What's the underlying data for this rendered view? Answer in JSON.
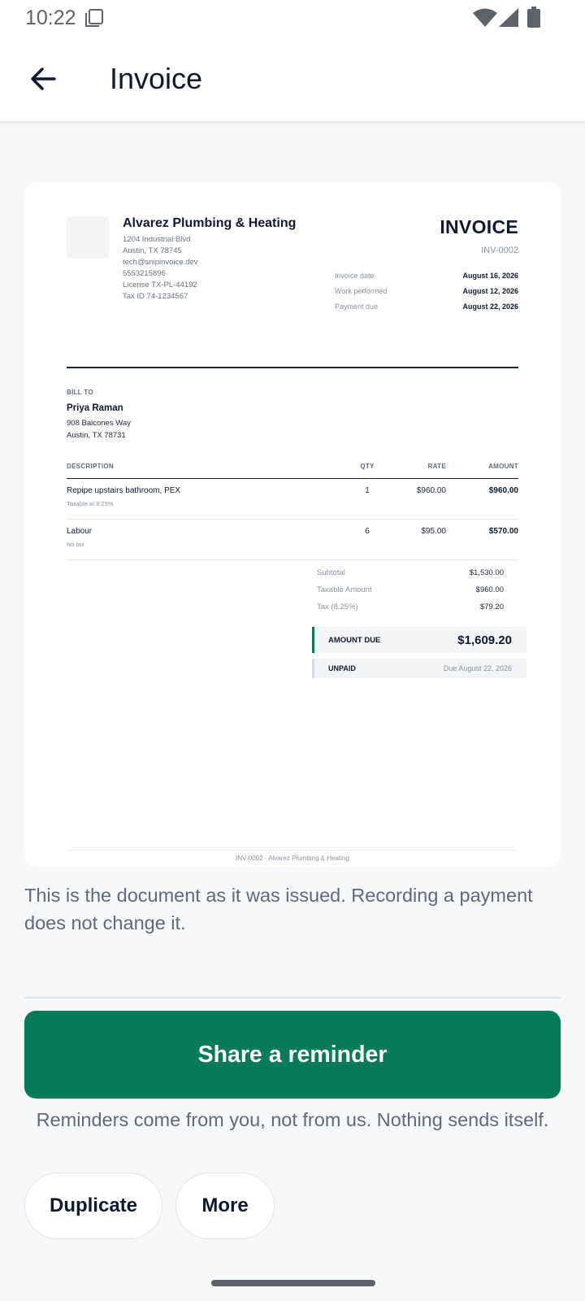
{
  "status_bar": {
    "time": "10:22"
  },
  "app_bar": {
    "title": "Invoice"
  },
  "invoice": {
    "business": {
      "name": "Alvarez Plumbing & Heating",
      "address_line1": "1204 Industrial Blvd",
      "address_line2": "Austin, TX 78745",
      "email": "tech@snipinvoice.dev",
      "phone": "5553215896",
      "license": "License TX-PL-44192",
      "tax_id": "Tax ID 74-1234567"
    },
    "title": "INVOICE",
    "number": "INV-0002",
    "meta": [
      {
        "label": "Invoice date",
        "value": "August 16, 2026"
      },
      {
        "label": "Work performed",
        "value": "August 12, 2026"
      },
      {
        "label": "Payment due",
        "value": "August 22, 2026"
      }
    ],
    "bill_to": {
      "label": "BILL TO",
      "name": "Priya Raman",
      "address_line1": "908 Balcones Way",
      "address_line2": "Austin, TX 78731"
    },
    "columns": {
      "description": "DESCRIPTION",
      "qty": "QTY",
      "rate": "RATE",
      "amount": "AMOUNT"
    },
    "items": [
      {
        "description": "Repipe upstairs bathroom, PEX",
        "note": "Taxable at 8.25%",
        "qty": "1",
        "rate": "$960.00",
        "amount": "$960.00"
      },
      {
        "description": "Labour",
        "note": "No tax",
        "qty": "6",
        "rate": "$95.00",
        "amount": "$570.00"
      }
    ],
    "totals": [
      {
        "label": "Subtotal",
        "value": "$1,530.00"
      },
      {
        "label": "Taxable Amount",
        "value": "$960.00"
      },
      {
        "label": "Tax (8.25%)",
        "value": "$79.20"
      }
    ],
    "amount_due_label": "AMOUNT DUE",
    "amount_due_value": "$1,609.20",
    "status_label": "UNPAID",
    "status_due": "Due August 22, 2026",
    "footer": "INV-0002 · Alvarez Plumbing & Heating"
  },
  "note": "This is the document as it was issued. Recording a payment does not change it.",
  "share_button": "Share a reminder",
  "reminder_note": "Reminders come from you, not from us. Nothing sends itself.",
  "actions": {
    "duplicate": "Duplicate",
    "more": "More"
  },
  "colors": {
    "accent": "#077a57",
    "background": "#f6f8fa"
  }
}
